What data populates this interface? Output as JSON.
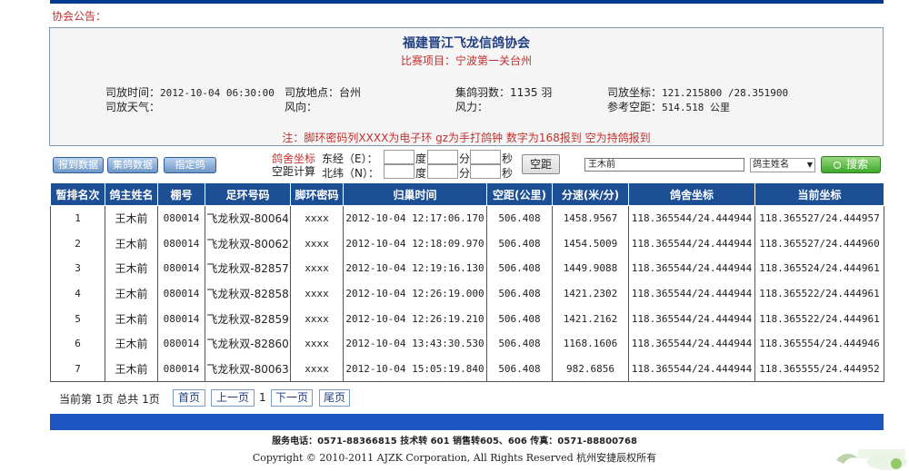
{
  "notice_label": "协会公告：",
  "race": {
    "title": "福建晋江飞龙信鸽协会",
    "subtitle": "比赛项目：宁波第一关台州",
    "release_time_label": "司放时间：",
    "release_time": "2012-10-04 06:30:00",
    "release_place_label": "司放地点：",
    "release_place": "台州",
    "count_label": "集鸽羽数：",
    "count": "1135 羽",
    "release_coord_label": "司放坐标：",
    "release_coord": "121.215800 /28.351900",
    "weather_label": "司放天气：",
    "weather": "",
    "wind_dir_label": "风向：",
    "wind_dir": "",
    "wind_power_label": "风力：",
    "wind_power": "",
    "ref_dist_label": "参考空距：",
    "ref_dist": "514.518 公里",
    "note": "注：脚环密码列XXXX为电子环 gz为手打鸽钟 数字为168报到 空为持鸽报到"
  },
  "toolbar": {
    "report_btn": "报到数据",
    "collect_btn": "集鸽数据",
    "assign_btn": "指定鸽",
    "loft_coord_label": "鸽舍坐标",
    "dist_calc_label": "空距计算",
    "east_label": "东经（E）：",
    "north_label": "北纬（N）：",
    "deg": "度",
    "min": "分",
    "sec": "秒",
    "distance_btn": "空距",
    "search_value": "王木前",
    "search_select": "鸽主姓名",
    "search_btn": "搜索"
  },
  "table": {
    "headers": [
      "暂排名次",
      "鸽主姓名",
      "棚号",
      "足环号码",
      "脚环密码",
      "归巢时间",
      "空距(公里)",
      "分速(米/分)",
      "鸽舍坐标",
      "当前坐标"
    ],
    "rows": [
      [
        "1",
        "王木前",
        "080014",
        "飞龙秋双-80064",
        "xxxx",
        "2012-10-04 12:17:06.170",
        "506.408",
        "1458.9567",
        "118.365544/24.444944",
        "118.365527/24.444957"
      ],
      [
        "2",
        "王木前",
        "080014",
        "飞龙秋双-80062",
        "xxxx",
        "2012-10-04 12:18:09.970",
        "506.408",
        "1454.5009",
        "118.365544/24.444944",
        "118.365527/24.444960"
      ],
      [
        "3",
        "王木前",
        "080014",
        "飞龙秋双-82857",
        "xxxx",
        "2012-10-04 12:19:16.130",
        "506.408",
        "1449.9088",
        "118.365544/24.444944",
        "118.365524/24.444961"
      ],
      [
        "4",
        "王木前",
        "080014",
        "飞龙秋双-82858",
        "xxxx",
        "2012-10-04 12:26:19.000",
        "506.408",
        "1421.2302",
        "118.365544/24.444944",
        "118.365522/24.444961"
      ],
      [
        "5",
        "王木前",
        "080014",
        "飞龙秋双-82859",
        "xxxx",
        "2012-10-04 12:26:19.210",
        "506.408",
        "1421.2162",
        "118.365544/24.444944",
        "118.365522/24.444961"
      ],
      [
        "6",
        "王木前",
        "080014",
        "飞龙秋双-82860",
        "xxxx",
        "2012-10-04 13:43:30.530",
        "506.408",
        "1168.1606",
        "118.365544/24.444944",
        "118.365554/24.444946"
      ],
      [
        "7",
        "王木前",
        "080014",
        "飞龙秋双-80063",
        "xxxx",
        "2012-10-04 15:05:19.840",
        "506.408",
        "982.6856",
        "118.365544/24.444944",
        "118.365555/24.444952"
      ]
    ]
  },
  "pager": {
    "status": "当前第 1页 总共 1页",
    "first": "首页",
    "prev": "上一页",
    "current": "1",
    "next": "下一页",
    "last": "尾页"
  },
  "footer": {
    "contact": "服务电话：0571-88366815 技术转 601 销售转605、606  传真：0571-88800768",
    "copyright": "Copyright © 2010-2011 AJZK Corporation, All Rights Reserved 杭州安捷辰权所有"
  },
  "colors": {
    "header_blue": "#1d4f95",
    "bar_blue": "#1d56c0",
    "accent_red": "#c0312e"
  }
}
